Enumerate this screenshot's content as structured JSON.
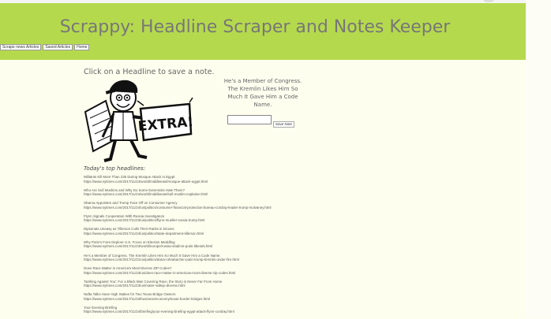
{
  "header": {
    "title": "Scrappy: Headline Scraper and Notes Keeper",
    "nav": [
      "Scrape news Articles",
      "Saved Articles",
      "Home"
    ]
  },
  "main": {
    "instruction": "Click on a Headline to save a note.",
    "mascot_sign": "EXTRA!",
    "note": {
      "headline": "He's a Member of Congress. The Kremlin Likes Him So Much It Gave Him a Code Name.",
      "input_value": "",
      "save_label": "Save Note"
    },
    "section_title": "Today's top headlines:",
    "headlines": [
      {
        "title": "Militants Kill More Than 235 During Mosque Attack in Egypt",
        "url": "https://www.nytimes.com/2017/11/24/world/middleeast/mosque-attack-egypt.html"
      },
      {
        "title": "Who Are Sufi Muslims and Why Do Some Extremists Hate Them?",
        "url": "https://www.nytimes.com/2017/11/24/world/middleeast/sufi-muslim-explainer.html"
      },
      {
        "title": "Obama Appointee and Trump Face Off on Consumer Agency",
        "url": "https://www.nytimes.com/2017/11/24/us/politics/consumer-financial-protection-bureau-cordray-leader-trump-mulvaney.html"
      },
      {
        "title": "Flynn Signals Cooperation With Russia Investigators",
        "url": "https://www.nytimes.com/2017/11/23/us/politics/flynn-mueller-russia-trump.html"
      },
      {
        "title": "Diplomats Uneasy as Tillerson Culls Their Ranks in Droves",
        "url": "https://www.nytimes.com/2017/11/24/us/politics/state-department-tillerson.html"
      },
      {
        "title": "Why Putin's Foes Deplore U.S. Focus on Election Meddling",
        "url": "https://www.nytimes.com/2017/11/23/world/europe/russia-vladimir-putin-liberals.html"
      },
      {
        "title": "He's a Member of Congress. The Kremlin Likes Him So Much It Gave Him a Code Name.",
        "url": "https://www.nytimes.com/2017/11/21/us/politics/dana-rohrabacher-putin-trump-kremlin-under-fire.html"
      },
      {
        "title": "Does Race Matter in America's Most Diverse ZIP Codes?",
        "url": "https://www.nytimes.com/2017/11/23/us/does-race-matter-in-americas-most-diverse-zip-codes.html"
      },
      {
        "title": "'Nothing Against You': For a Black Man Covering Race, the Story is Never Far From Home",
        "url": "https://www.nytimes.com/2017/11/23/us/mater-vallejo-diverse.html"
      },
      {
        "title": "Nafta Talks Have High Stakes for Two Texas Bridge Owners",
        "url": "https://www.nytimes.com/2017/11/23/business/economy/texas-border-bridges.html"
      },
      {
        "title": "Your Evening Briefing",
        "url": "https://www.nytimes.com/2017/11/24/briefing/your-evening-briefing-egypt-attack-flynn-cordray.html"
      }
    ]
  }
}
